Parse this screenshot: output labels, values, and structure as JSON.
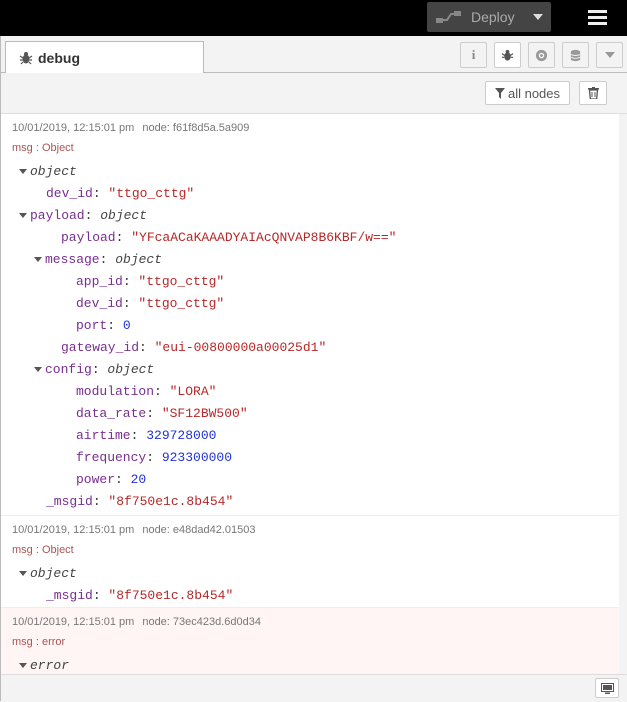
{
  "header": {
    "deploy_label": "Deploy"
  },
  "sidebar": {
    "tab_label": "debug",
    "filter_label": "all nodes"
  },
  "messages": [
    {
      "timestamp": "10/01/2019, 12:15:01 pm",
      "node": "node: f61f8d5a.5a909",
      "topic": "msg : Object",
      "lines": [
        {
          "indent": 0,
          "caret": true,
          "key": "",
          "value": "object",
          "vtype": "type"
        },
        {
          "indent": 1,
          "caret": false,
          "key": "dev_id",
          "value": "\"ttgo_cttg\"",
          "vtype": "str"
        },
        {
          "indent": 0,
          "caret": true,
          "key": "payload",
          "value": "object",
          "vtype": "type"
        },
        {
          "indent": 2,
          "caret": false,
          "key": "payload",
          "value": "\"YFcaACaKAAADYAIAcQNVAP8B6KBF/w==\"",
          "vtype": "str"
        },
        {
          "indent": 1,
          "caret": true,
          "key": "message",
          "value": "object",
          "vtype": "type"
        },
        {
          "indent": 3,
          "caret": false,
          "key": "app_id",
          "value": "\"ttgo_cttg\"",
          "vtype": "str"
        },
        {
          "indent": 3,
          "caret": false,
          "key": "dev_id",
          "value": "\"ttgo_cttg\"",
          "vtype": "str"
        },
        {
          "indent": 3,
          "caret": false,
          "key": "port",
          "value": "0",
          "vtype": "num"
        },
        {
          "indent": 2,
          "caret": false,
          "key": "gateway_id",
          "value": "\"eui-00800000a00025d1\"",
          "vtype": "str"
        },
        {
          "indent": 1,
          "caret": true,
          "key": "config",
          "value": "object",
          "vtype": "type"
        },
        {
          "indent": 3,
          "caret": false,
          "key": "modulation",
          "value": "\"LORA\"",
          "vtype": "str"
        },
        {
          "indent": 3,
          "caret": false,
          "key": "data_rate",
          "value": "\"SF12BW500\"",
          "vtype": "str"
        },
        {
          "indent": 3,
          "caret": false,
          "key": "airtime",
          "value": "329728000",
          "vtype": "num"
        },
        {
          "indent": 3,
          "caret": false,
          "key": "frequency",
          "value": "923300000",
          "vtype": "num"
        },
        {
          "indent": 3,
          "caret": false,
          "key": "power",
          "value": "20",
          "vtype": "num"
        },
        {
          "indent": 1,
          "caret": false,
          "key": "_msgid",
          "value": "\"8f750e1c.8b454\"",
          "vtype": "str"
        }
      ]
    },
    {
      "timestamp": "10/01/2019, 12:15:01 pm",
      "node": "node: e48dad42.01503",
      "topic": "msg : Object",
      "lines": [
        {
          "indent": 0,
          "caret": true,
          "key": "",
          "value": "object",
          "vtype": "type"
        },
        {
          "indent": 1,
          "caret": false,
          "key": "_msgid",
          "value": "\"8f750e1c.8b454\"",
          "vtype": "str"
        }
      ]
    },
    {
      "timestamp": "10/01/2019, 12:15:01 pm",
      "node": "node: 73ec423d.6d0d34",
      "topic": "msg : error",
      "lines": [
        {
          "indent": 0,
          "caret": true,
          "key": "",
          "value": "error",
          "vtype": "type"
        }
      ]
    }
  ],
  "colors": {
    "header_bg": "#000000",
    "error_bar": "#ff9999",
    "string": "#b72828",
    "number": "#2033d6"
  }
}
